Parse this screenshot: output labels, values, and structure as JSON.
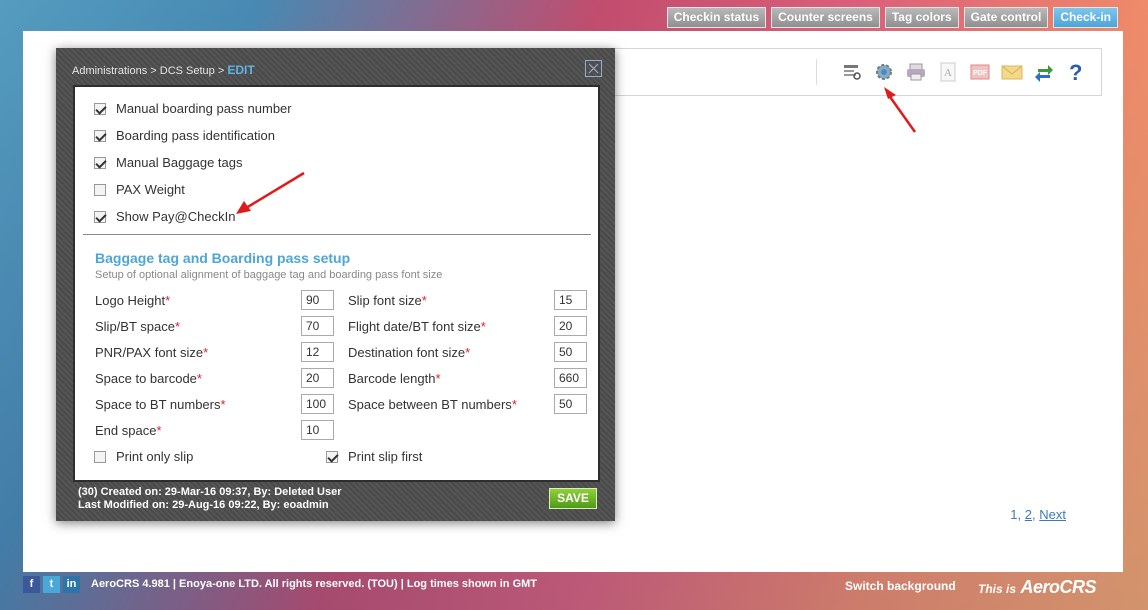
{
  "top_nav": {
    "buttons": [
      {
        "label": "Checkin status"
      },
      {
        "label": "Counter screens"
      },
      {
        "label": "Tag colors"
      },
      {
        "label": "Gate control"
      },
      {
        "label": "Check-in"
      }
    ]
  },
  "pager": {
    "page1": "1",
    "sep1": ",",
    "page2": "2",
    "sep2": ",",
    "next": "Next"
  },
  "modal": {
    "breadcrumb": {
      "part1": "Administrations",
      "sep1": ">",
      "part2": "DCS Setup",
      "sep2": ">",
      "current": "EDIT"
    },
    "checkboxes": [
      {
        "label": "Manual boarding pass number",
        "checked": true
      },
      {
        "label": "Boarding pass identification",
        "checked": true
      },
      {
        "label": "Manual Baggage tags",
        "checked": true
      },
      {
        "label": "PAX Weight",
        "checked": false
      },
      {
        "label": "Show Pay@CheckIn",
        "checked": true
      }
    ],
    "section_title": "Baggage tag and Boarding pass setup",
    "section_subtitle": "Setup of optional alignment of baggage tag and boarding pass font size",
    "fields_left": [
      {
        "label": "Logo Height",
        "value": "90"
      },
      {
        "label": "Slip/BT space",
        "value": "70"
      },
      {
        "label": "PNR/PAX font size",
        "value": "12"
      },
      {
        "label": "Space to barcode",
        "value": "20"
      },
      {
        "label": "Space to BT numbers",
        "value": "100"
      },
      {
        "label": "End space",
        "value": "10"
      }
    ],
    "fields_right": [
      {
        "label": "Slip font size",
        "value": "15"
      },
      {
        "label": "Flight date/BT font size",
        "value": "20"
      },
      {
        "label": "Destination font size",
        "value": "50"
      },
      {
        "label": "Barcode length",
        "value": "660"
      },
      {
        "label": "Space between BT numbers",
        "value": "50"
      }
    ],
    "required_mark": "*",
    "print_only_slip": {
      "label": "Print only slip",
      "checked": false
    },
    "print_slip_first": {
      "label": "Print slip first",
      "checked": true
    },
    "footer_created": "(30) Created on: 29-Mar-16 09:37, By: Deleted User",
    "footer_modified": "Last Modified on: 29-Aug-16 09:22, By: eoadmin",
    "save_label": "SAVE"
  },
  "footer": {
    "copyright": "AeroCRS 4.981  | Enoya-one LTD. All rights reserved. (TOU)  | Log times shown in GMT",
    "switch_background": "Switch background",
    "brand_prefix": "This is",
    "brand_logo": "AeroCRS"
  },
  "colors": {
    "accent": "#4ea6d6",
    "save": "#5aa61f",
    "required": "#d9232d",
    "arrow": "#e01b1b"
  },
  "icons": [
    "report-icon",
    "settings-icon",
    "print-icon",
    "font-icon",
    "pdf-icon",
    "mail-icon",
    "refresh-icon",
    "help-icon"
  ]
}
